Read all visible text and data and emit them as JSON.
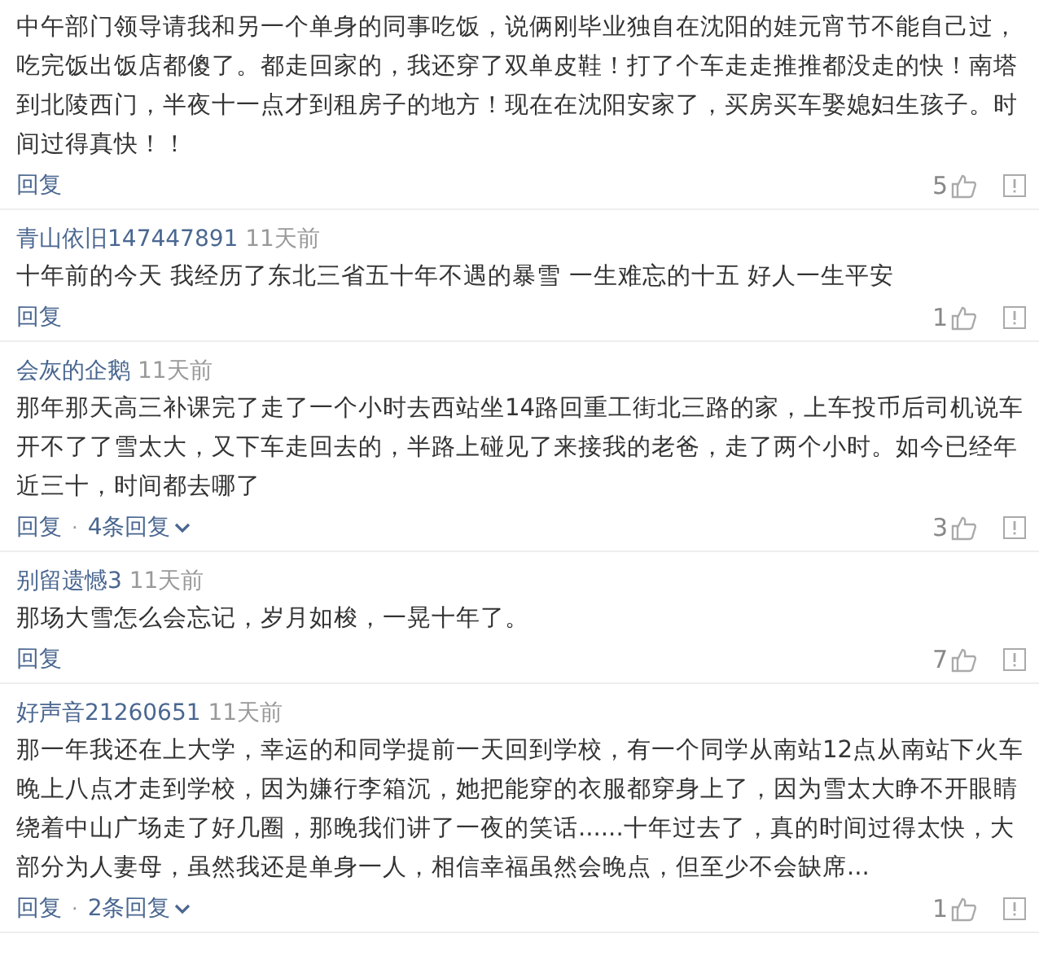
{
  "comments": [
    {
      "text": "中午部门领导请我和另一个单身的同事吃饭，说俩刚毕业独自在沈阳的娃元宵节不能自己过，吃完饭出饭店都傻了。都走回家的，我还穿了双单皮鞋！打了个车走走推推都没走的快！南塔到北陵西门，半夜十一点才到租房子的地方！现在在沈阳安家了，买房买车娶媳妇生孩子。时间过得真快！！",
      "reply": "回复",
      "likes": "5"
    },
    {
      "author": "青山依旧147447891",
      "time": "11天前",
      "text": "十年前的今天 我经历了东北三省五十年不遇的暴雪 一生难忘的十五 好人一生平安",
      "reply": "回复",
      "likes": "1"
    },
    {
      "author": "会灰的企鹅",
      "time": "11天前",
      "text": "那年那天高三补课完了走了一个小时去西站坐14路回重工街北三路的家，上车投币后司机说车开不了了雪太大，又下车走回去的，半路上碰见了来接我的老爸，走了两个小时。如今已经年近三十，时间都去哪了",
      "reply": "回复",
      "separator": "·",
      "replies": "4条回复",
      "likes": "3"
    },
    {
      "author": "别留遗憾3",
      "time": "11天前",
      "text": "那场大雪怎么会忘记，岁月如梭，一晃十年了。",
      "reply": "回复",
      "likes": "7"
    },
    {
      "author": "好声音21260651",
      "time": "11天前",
      "text": "那一年我还在上大学，幸运的和同学提前一天回到学校，有一个同学从南站12点从南站下火车晚上八点才走到学校，因为嫌行李箱沉，她把能穿的衣服都穿身上了，因为雪太大睁不开眼睛绕着中山广场走了好几圈，那晚我们讲了一夜的笑话......十年过去了，真的时间过得太快，大部分为人妻母，虽然我还是单身一人，相信幸福虽然会晚点，但至少不会缺席...",
      "reply": "回复",
      "separator": "·",
      "replies": "2条回复",
      "likes": "1"
    }
  ]
}
